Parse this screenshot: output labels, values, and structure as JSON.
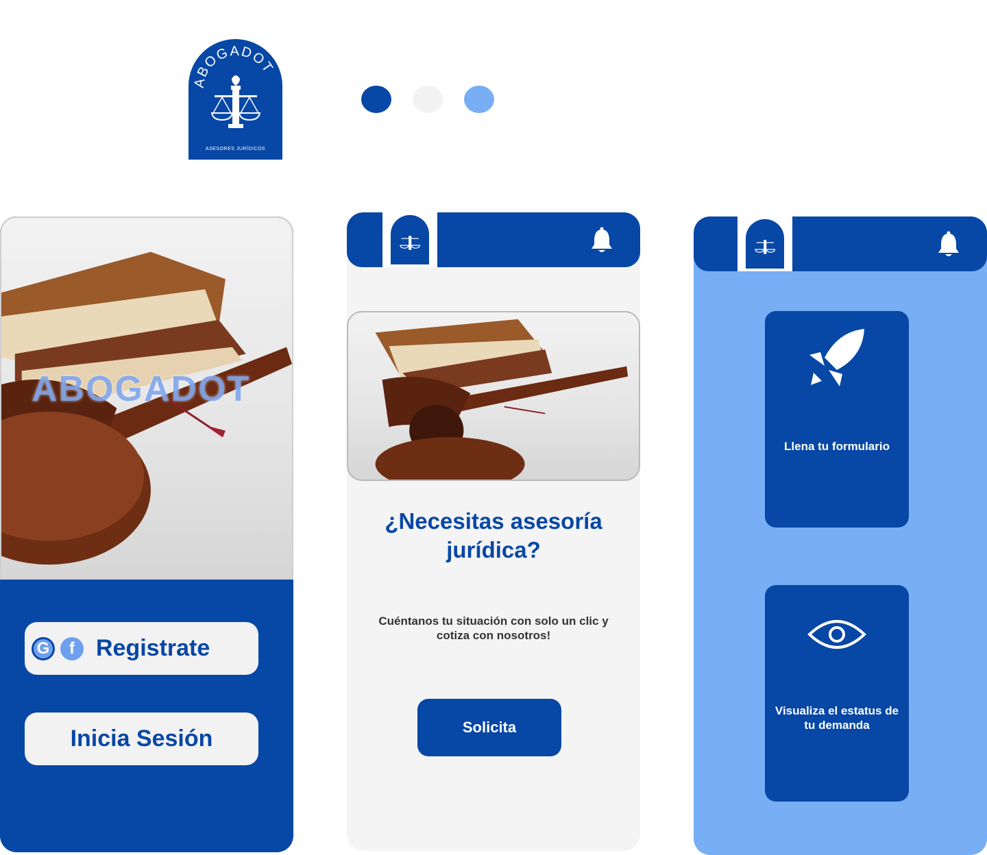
{
  "brand": {
    "name": "ABOGADOT",
    "tagline": "ASESORES JURÍDICOS"
  },
  "palette": {
    "primary": "#0747a6",
    "light": "#f2f2f2",
    "accent": "#77aef4"
  },
  "screen_login": {
    "hero_text": "ABOGADOT",
    "register_label": "Registrate",
    "register_icons": [
      "google-icon",
      "facebook-icon"
    ],
    "google_glyph": "G",
    "facebook_glyph": "f",
    "login_label": "Inicia Sesión"
  },
  "screen_home": {
    "question": "¿Necesitas asesoría jurídica?",
    "subtitle": "Cuéntanos tu situación con solo un clic y cotiza con nosotros!",
    "cta_label": "Solicita"
  },
  "screen_menu": {
    "cards": [
      {
        "icon": "rocket-icon",
        "label": "Llena tu formulario"
      },
      {
        "icon": "eye-icon",
        "label": "Visualiza el estatus de tu demanda"
      }
    ]
  }
}
